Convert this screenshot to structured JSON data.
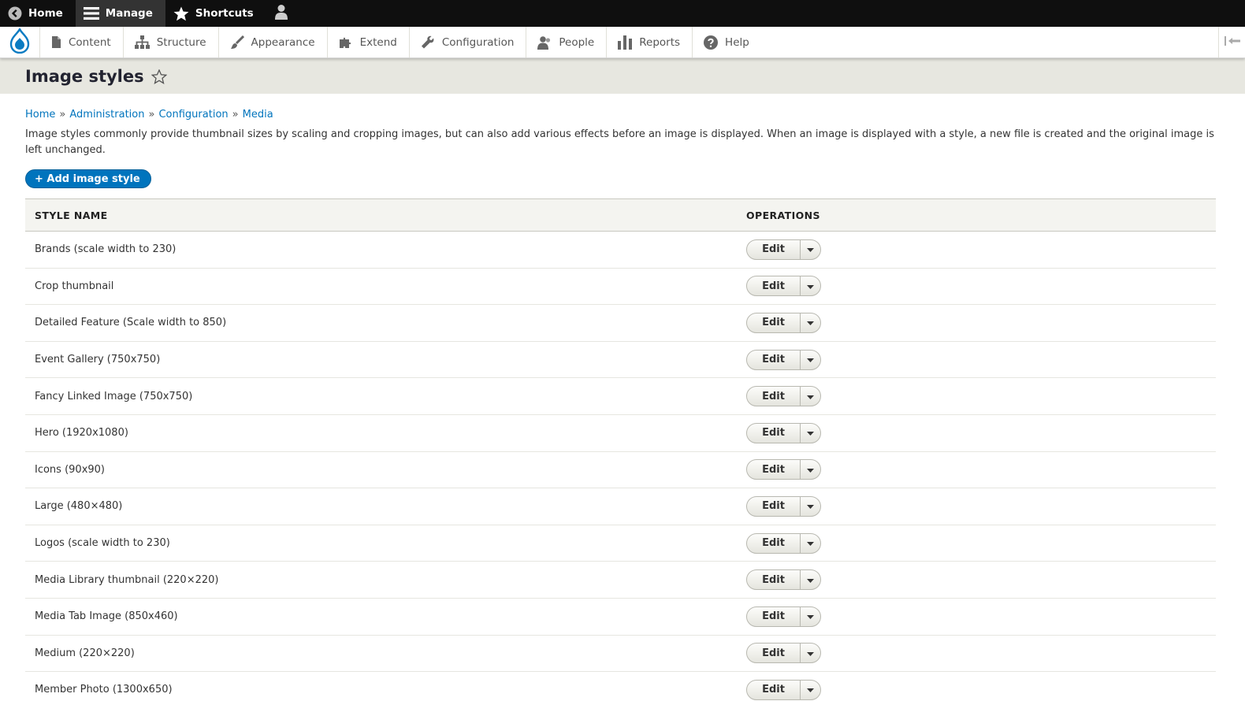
{
  "toolbar": {
    "home_label": "Home",
    "manage_label": "Manage",
    "shortcuts_label": "Shortcuts"
  },
  "tray": {
    "items": [
      {
        "label": "Content",
        "icon": "file-icon"
      },
      {
        "label": "Structure",
        "icon": "sitemap-icon"
      },
      {
        "label": "Appearance",
        "icon": "paintbrush-icon"
      },
      {
        "label": "Extend",
        "icon": "puzzle-icon"
      },
      {
        "label": "Configuration",
        "icon": "wrench-icon"
      },
      {
        "label": "People",
        "icon": "people-icon"
      },
      {
        "label": "Reports",
        "icon": "bar-chart-icon"
      },
      {
        "label": "Help",
        "icon": "question-icon"
      }
    ]
  },
  "page": {
    "title": "Image styles"
  },
  "breadcrumb": [
    "Home",
    "Administration",
    "Configuration",
    "Media"
  ],
  "breadcrumb_sep": "»",
  "description": "Image styles commonly provide thumbnail sizes by scaling and cropping images, but can also add various effects before an image is displayed. When an image is displayed with a style, a new file is created and the original image is left unchanged.",
  "add_button_label": "+ Add image style",
  "table": {
    "headers": [
      "STYLE NAME",
      "OPERATIONS"
    ],
    "edit_label": "Edit",
    "rows": [
      "Brands (scale width to 230)",
      "Crop thumbnail",
      "Detailed Feature (Scale width to 850)",
      "Event Gallery (750x750)",
      "Fancy Linked Image (750x750)",
      "Hero (1920x1080)",
      "Icons (90x90)",
      "Large (480×480)",
      "Logos (scale width to 230)",
      "Media Library thumbnail (220×220)",
      "Media Tab Image (850x460)",
      "Medium (220×220)",
      "Member Photo (1300x650)"
    ]
  },
  "colors": {
    "accent": "#0074bd",
    "toolbar_bg": "#0f0f0f",
    "header_bg": "#e7e7e0"
  }
}
